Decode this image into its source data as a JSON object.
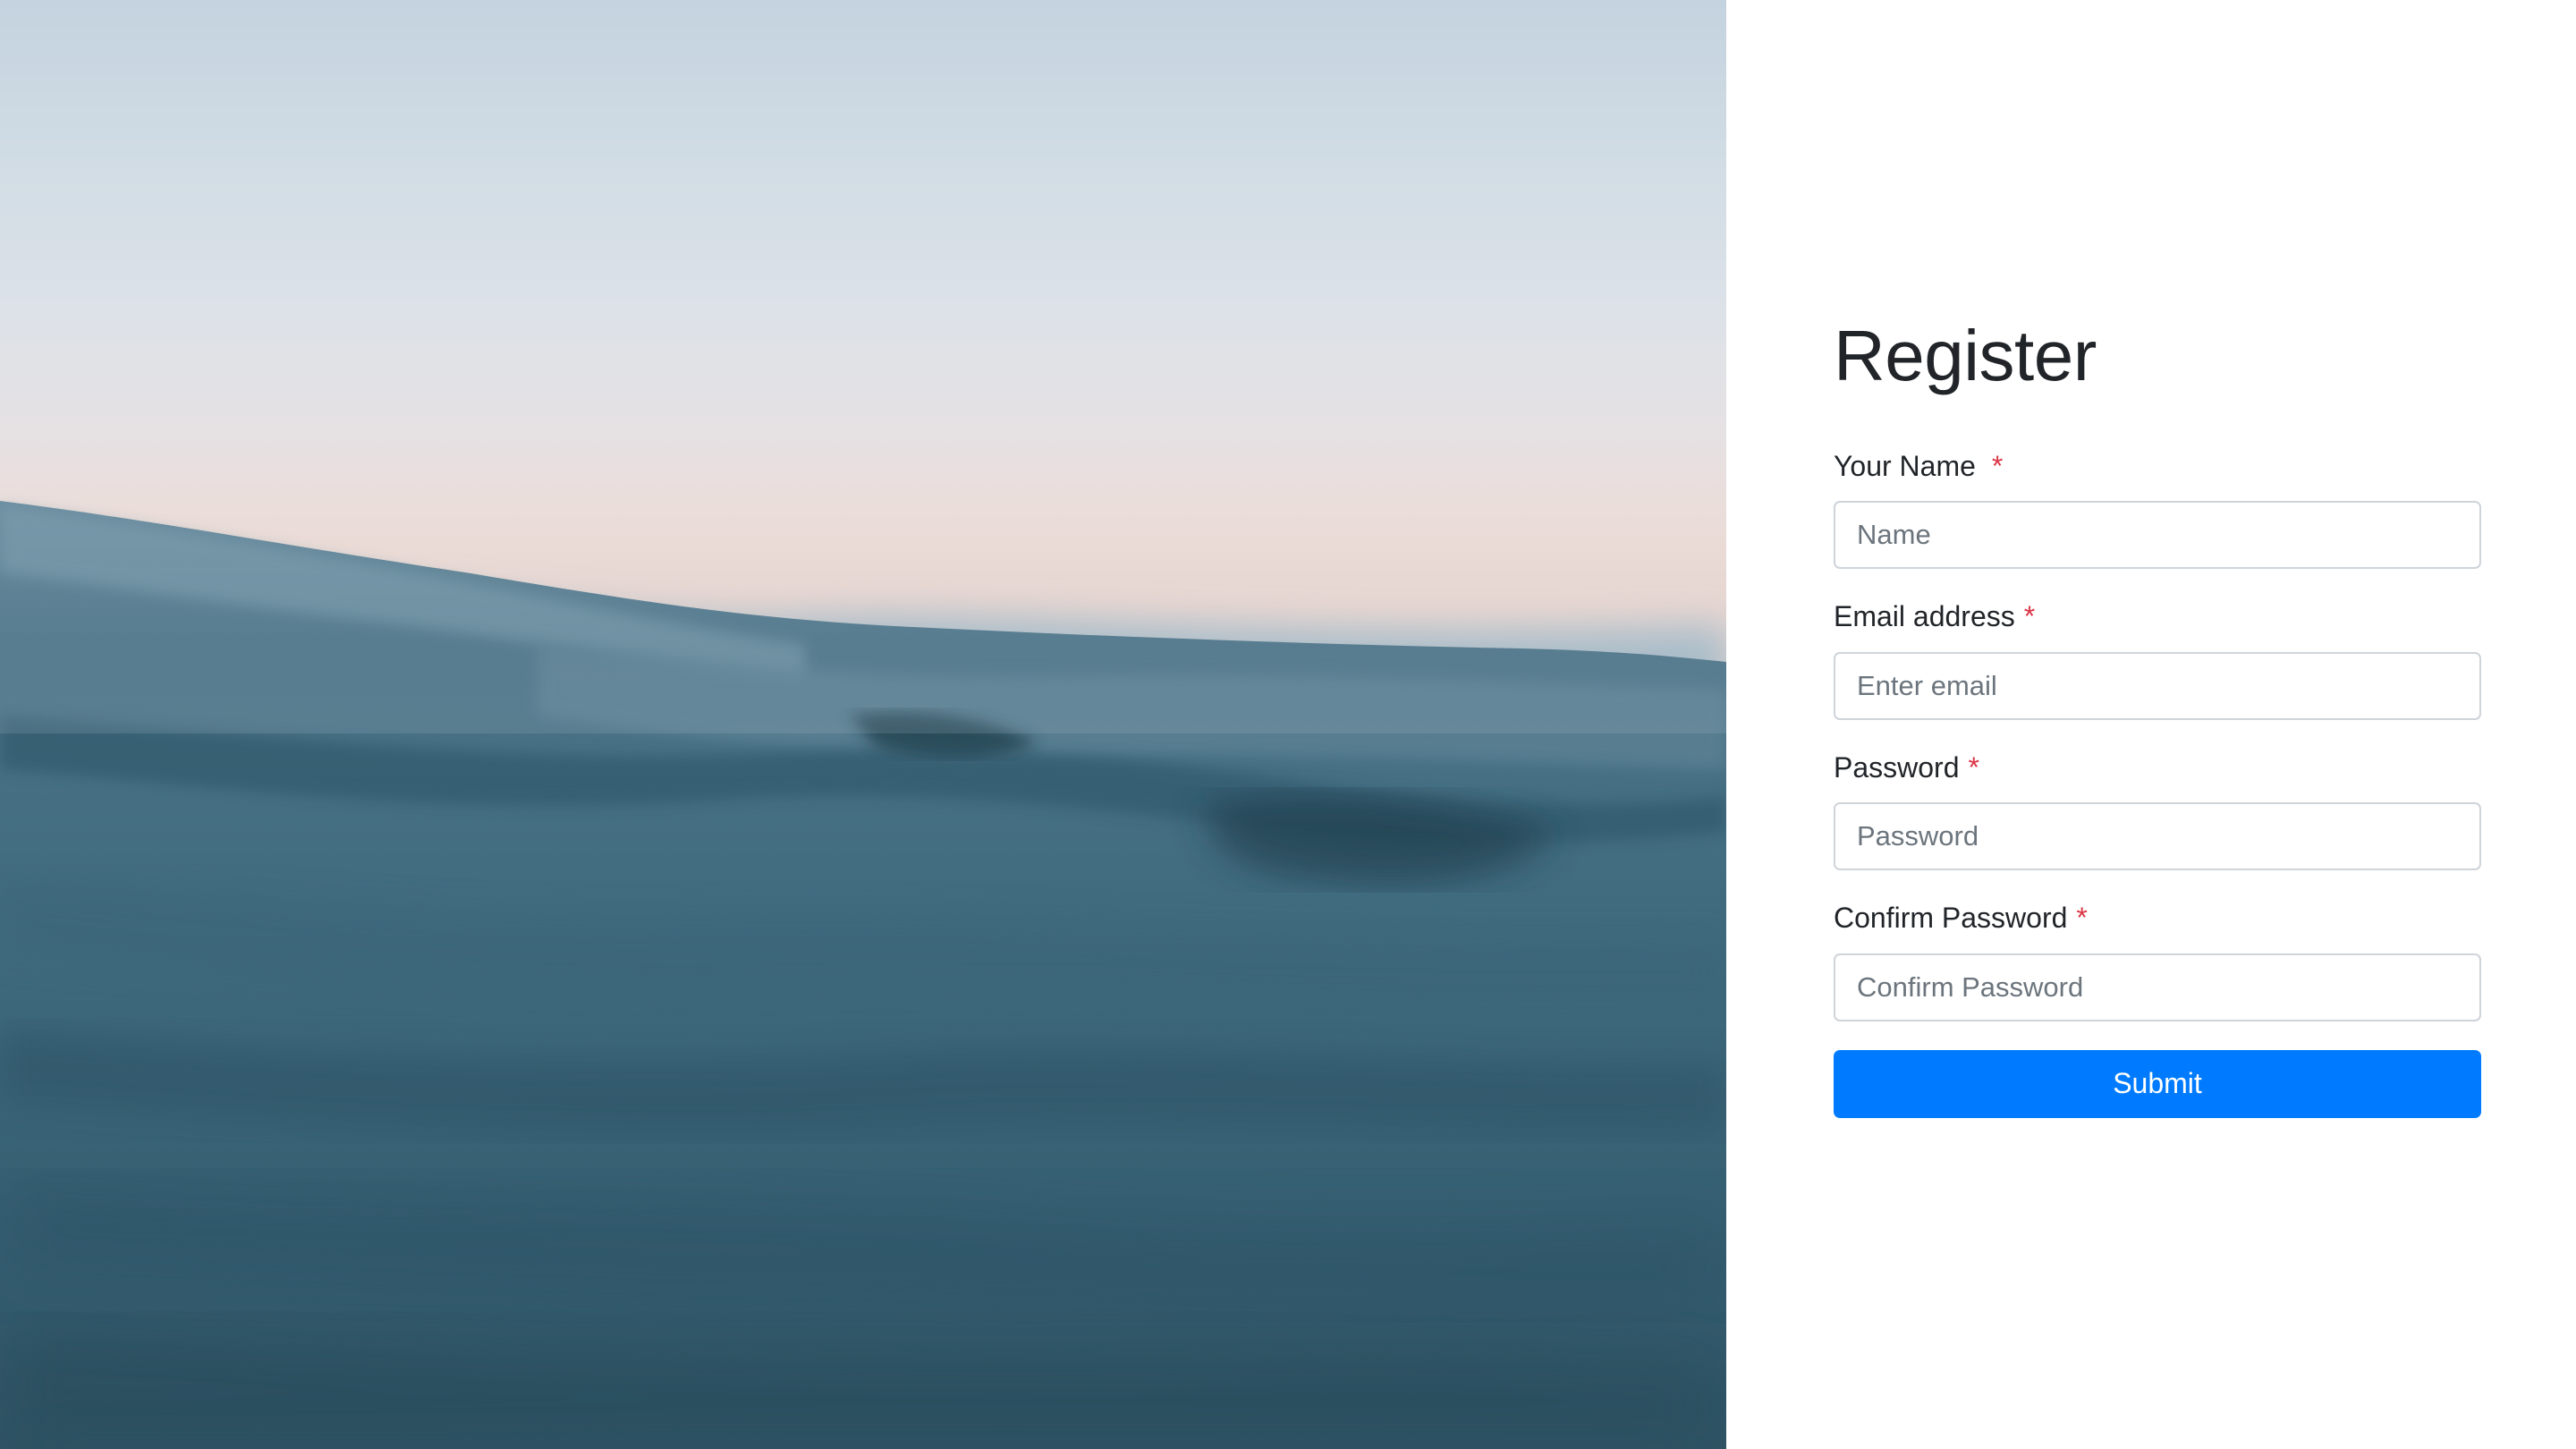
{
  "hero": {
    "image": "ocean-wave-photo"
  },
  "form": {
    "title": "Register",
    "required_marker": "*",
    "fields": [
      {
        "label": "Your Name",
        "placeholder": "Name",
        "type": "text",
        "value": ""
      },
      {
        "label": "Email address",
        "placeholder": "Enter email",
        "type": "email",
        "value": ""
      },
      {
        "label": "Password",
        "placeholder": "Password",
        "type": "password",
        "value": ""
      },
      {
        "label": "Confirm Password",
        "placeholder": "Confirm Password",
        "type": "password",
        "value": ""
      }
    ],
    "submit_label": "Submit"
  },
  "colors": {
    "accent": "#007bff",
    "required": "#dc3545",
    "text": "#212529",
    "placeholder": "#6c757d",
    "input_border": "#ced4da"
  }
}
